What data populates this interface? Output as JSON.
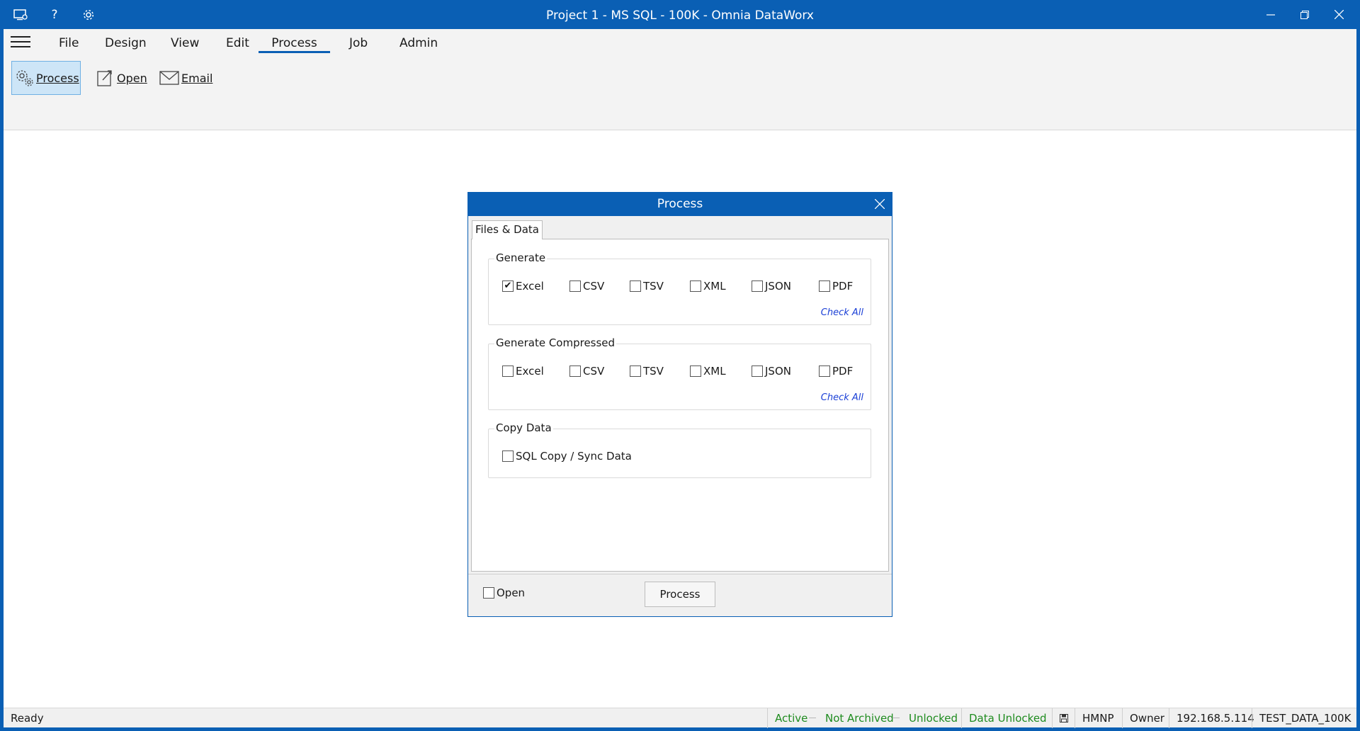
{
  "window": {
    "title": "Project 1 - MS SQL - 100K - Omnia DataWorx"
  },
  "menu": {
    "items": [
      "File",
      "Design",
      "View",
      "Edit",
      "Process",
      "Job",
      "Admin"
    ],
    "active": "Process"
  },
  "toolbar": {
    "process_label": "Process",
    "open_label": "Open",
    "email_label": "Email"
  },
  "dialog": {
    "title": "Process",
    "tab_label": "Files & Data",
    "generate": {
      "label": "Generate",
      "options": [
        {
          "label": "Excel",
          "checked": true
        },
        {
          "label": "CSV",
          "checked": false
        },
        {
          "label": "TSV",
          "checked": false
        },
        {
          "label": "XML",
          "checked": false
        },
        {
          "label": "JSON",
          "checked": false
        },
        {
          "label": "PDF",
          "checked": false
        }
      ],
      "check_all": "Check All"
    },
    "generate_compressed": {
      "label": "Generate Compressed",
      "options": [
        {
          "label": "Excel",
          "checked": false
        },
        {
          "label": "CSV",
          "checked": false
        },
        {
          "label": "TSV",
          "checked": false
        },
        {
          "label": "XML",
          "checked": false
        },
        {
          "label": "JSON",
          "checked": false
        },
        {
          "label": "PDF",
          "checked": false
        }
      ],
      "check_all": "Check All"
    },
    "copy_data": {
      "label": "Copy Data",
      "option": {
        "label": "SQL Copy / Sync Data",
        "checked": false
      }
    },
    "footer": {
      "open_label": "Open",
      "open_checked": false,
      "process_button": "Process"
    }
  },
  "status": {
    "ready": "Ready",
    "active": "Active",
    "archived": "Not Archived",
    "lock": "Unlocked",
    "data_lock": "Data Unlocked",
    "host": "HMNP",
    "role": "Owner",
    "ip": "192.168.5.114",
    "database": "TEST_DATA_100K",
    "status_color": "#1e8b1e"
  },
  "colors": {
    "accent": "#0a5fb4",
    "link": "#1a3fd6"
  }
}
